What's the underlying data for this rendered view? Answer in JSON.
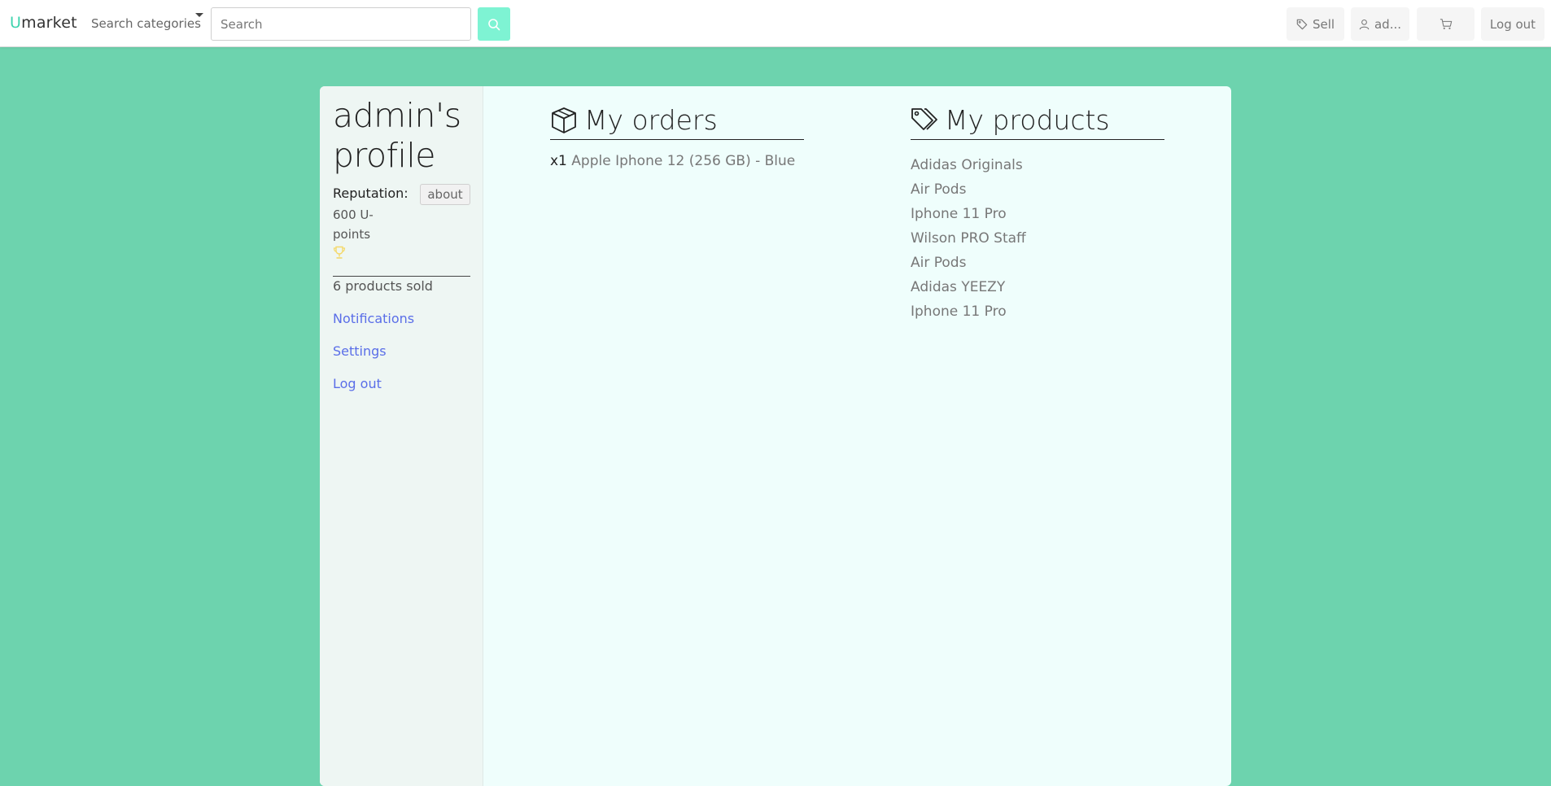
{
  "navbar": {
    "brand_first": "U",
    "brand_rest": "market",
    "categories_label": "Search categories",
    "search_placeholder": "Search",
    "sell_label": "Sell",
    "user_label": "ad...",
    "logout_label": "Log out",
    "icons": {
      "search": "search-icon",
      "sell": "tag-icon",
      "user": "user-icon",
      "cart": "cart-icon"
    }
  },
  "sidebar": {
    "title": "admin's profile",
    "reputation_label": "Reputation:",
    "about_label": "about",
    "points": "600 U-points",
    "products_sold": "6 products sold",
    "links": {
      "notifications": "Notifications",
      "settings": "Settings",
      "logout": "Log out"
    }
  },
  "orders": {
    "title": "My orders",
    "items": [
      {
        "quantity": "x1",
        "name": "Apple Iphone 12 (256 GB) - Blue"
      }
    ]
  },
  "products": {
    "title": "My products",
    "items": [
      "Adidas Originals",
      "Air Pods",
      "Iphone 11 Pro",
      "Wilson PRO Staff",
      "Air Pods",
      "Adidas YEEZY",
      "Iphone 11 Pro"
    ]
  },
  "colors": {
    "page_background": "#6dd3ae",
    "accent": "#3fd3ae",
    "search_button": "#7ef3d3",
    "link": "#5a6ee8",
    "trophy": "#f4d96b"
  }
}
